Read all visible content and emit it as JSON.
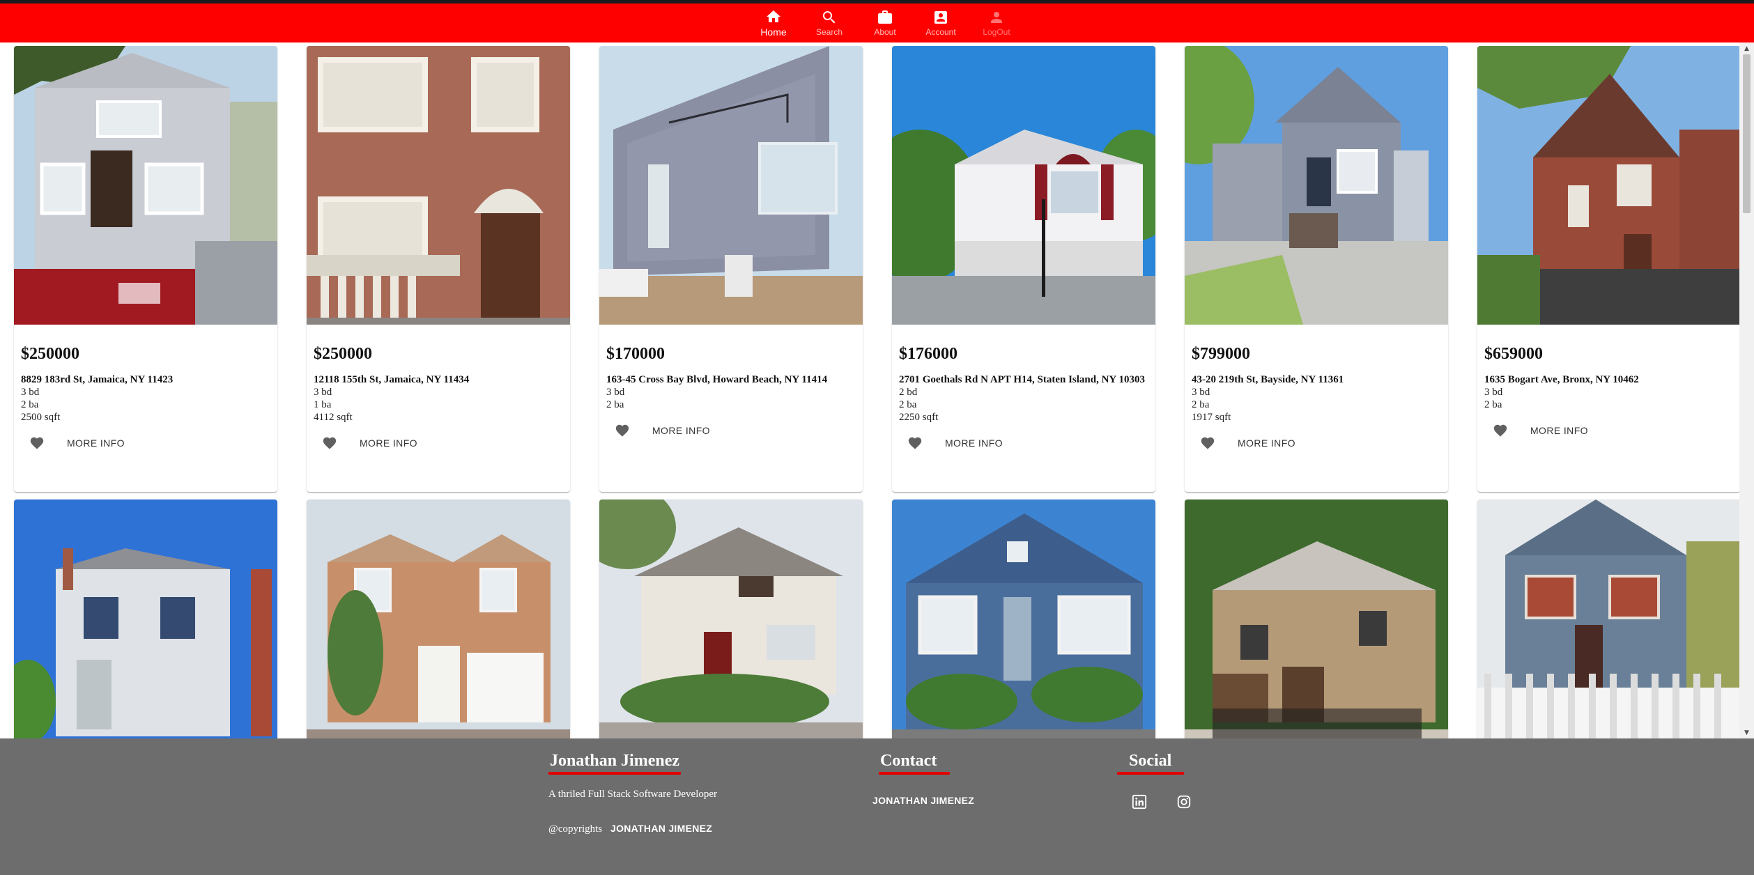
{
  "nav": {
    "items": [
      {
        "label": "Home",
        "icon": "home-icon"
      },
      {
        "label": "Search",
        "icon": "search-icon"
      },
      {
        "label": "About",
        "icon": "briefcase-icon"
      },
      {
        "label": "Account",
        "icon": "account-box-icon"
      },
      {
        "label": "LogOut",
        "icon": "person-icon"
      }
    ]
  },
  "listings": [
    {
      "price": "$250000",
      "address": "8829 183rd St, Jamaica, NY 11423",
      "beds": "3 bd",
      "baths": "2 ba",
      "sqft": "2500 sqft",
      "action": "MORE INFO"
    },
    {
      "price": "$250000",
      "address": "12118 155th St, Jamaica, NY 11434",
      "beds": "3 bd",
      "baths": "1 ba",
      "sqft": "4112 sqft",
      "action": "MORE INFO"
    },
    {
      "price": "$170000",
      "address": "163-45 Cross Bay Blvd, Howard Beach, NY 11414",
      "beds": "3 bd",
      "baths": "2 ba",
      "sqft": "",
      "action": "MORE INFO"
    },
    {
      "price": "$176000",
      "address": "2701 Goethals Rd N APT H14, Staten Island, NY 10303",
      "beds": "2 bd",
      "baths": "2 ba",
      "sqft": "2250 sqft",
      "action": "MORE INFO"
    },
    {
      "price": "$799000",
      "address": "43-20 219th St, Bayside, NY 11361",
      "beds": "3 bd",
      "baths": "2 ba",
      "sqft": "1917 sqft",
      "action": "MORE INFO"
    },
    {
      "price": "$659000",
      "address": "1635 Bogart Ave, Bronx, NY 10462",
      "beds": "3 bd",
      "baths": "2 ba",
      "sqft": "",
      "action": "MORE INFO"
    }
  ],
  "footer": {
    "about_heading": "Jonathan Jimenez",
    "tagline": "A thriled Full Stack Software Developer",
    "copyright_prefix": "@copyrights",
    "copyright_name": "JONATHAN JIMENEZ",
    "contact_heading": "Contact",
    "contact_name": "JONATHAN JIMENEZ",
    "social_heading": "Social",
    "social_icons": [
      "linkedin-icon",
      "instagram-icon"
    ]
  },
  "colors": {
    "nav_bg": "#ff0000",
    "footer_bg": "#6d6d6d",
    "underline": "#e00000"
  }
}
